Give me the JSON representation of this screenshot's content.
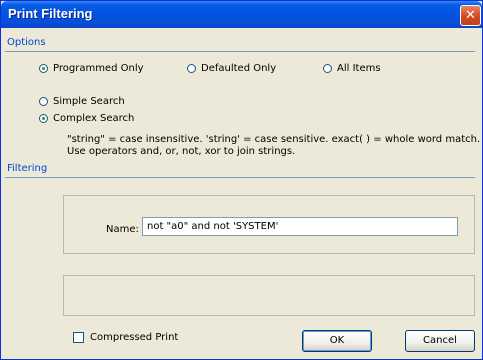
{
  "window": {
    "title": "Print Filtering",
    "close_glyph": "✕"
  },
  "options": {
    "header": "Options",
    "display_mode": [
      {
        "label": "Programmed Only",
        "checked": true
      },
      {
        "label": "Defaulted Only",
        "checked": false
      },
      {
        "label": "All Items",
        "checked": false
      }
    ],
    "search_mode": [
      {
        "label": "Simple Search",
        "checked": false
      },
      {
        "label": "Complex Search",
        "checked": true
      }
    ],
    "help_line1": "\"string\" = case insensitive. 'string' = case sensitive. exact( ) = whole word match.",
    "help_line2": "Use operators and, or, not, xor to join strings."
  },
  "filtering": {
    "header": "Filtering",
    "name_label": "Name:",
    "name_value": "not \"a0\" and not 'SYSTEM'"
  },
  "footer": {
    "compressed_label": "Compressed Print",
    "compressed_checked": false,
    "ok_label": "OK",
    "cancel_label": "Cancel"
  }
}
